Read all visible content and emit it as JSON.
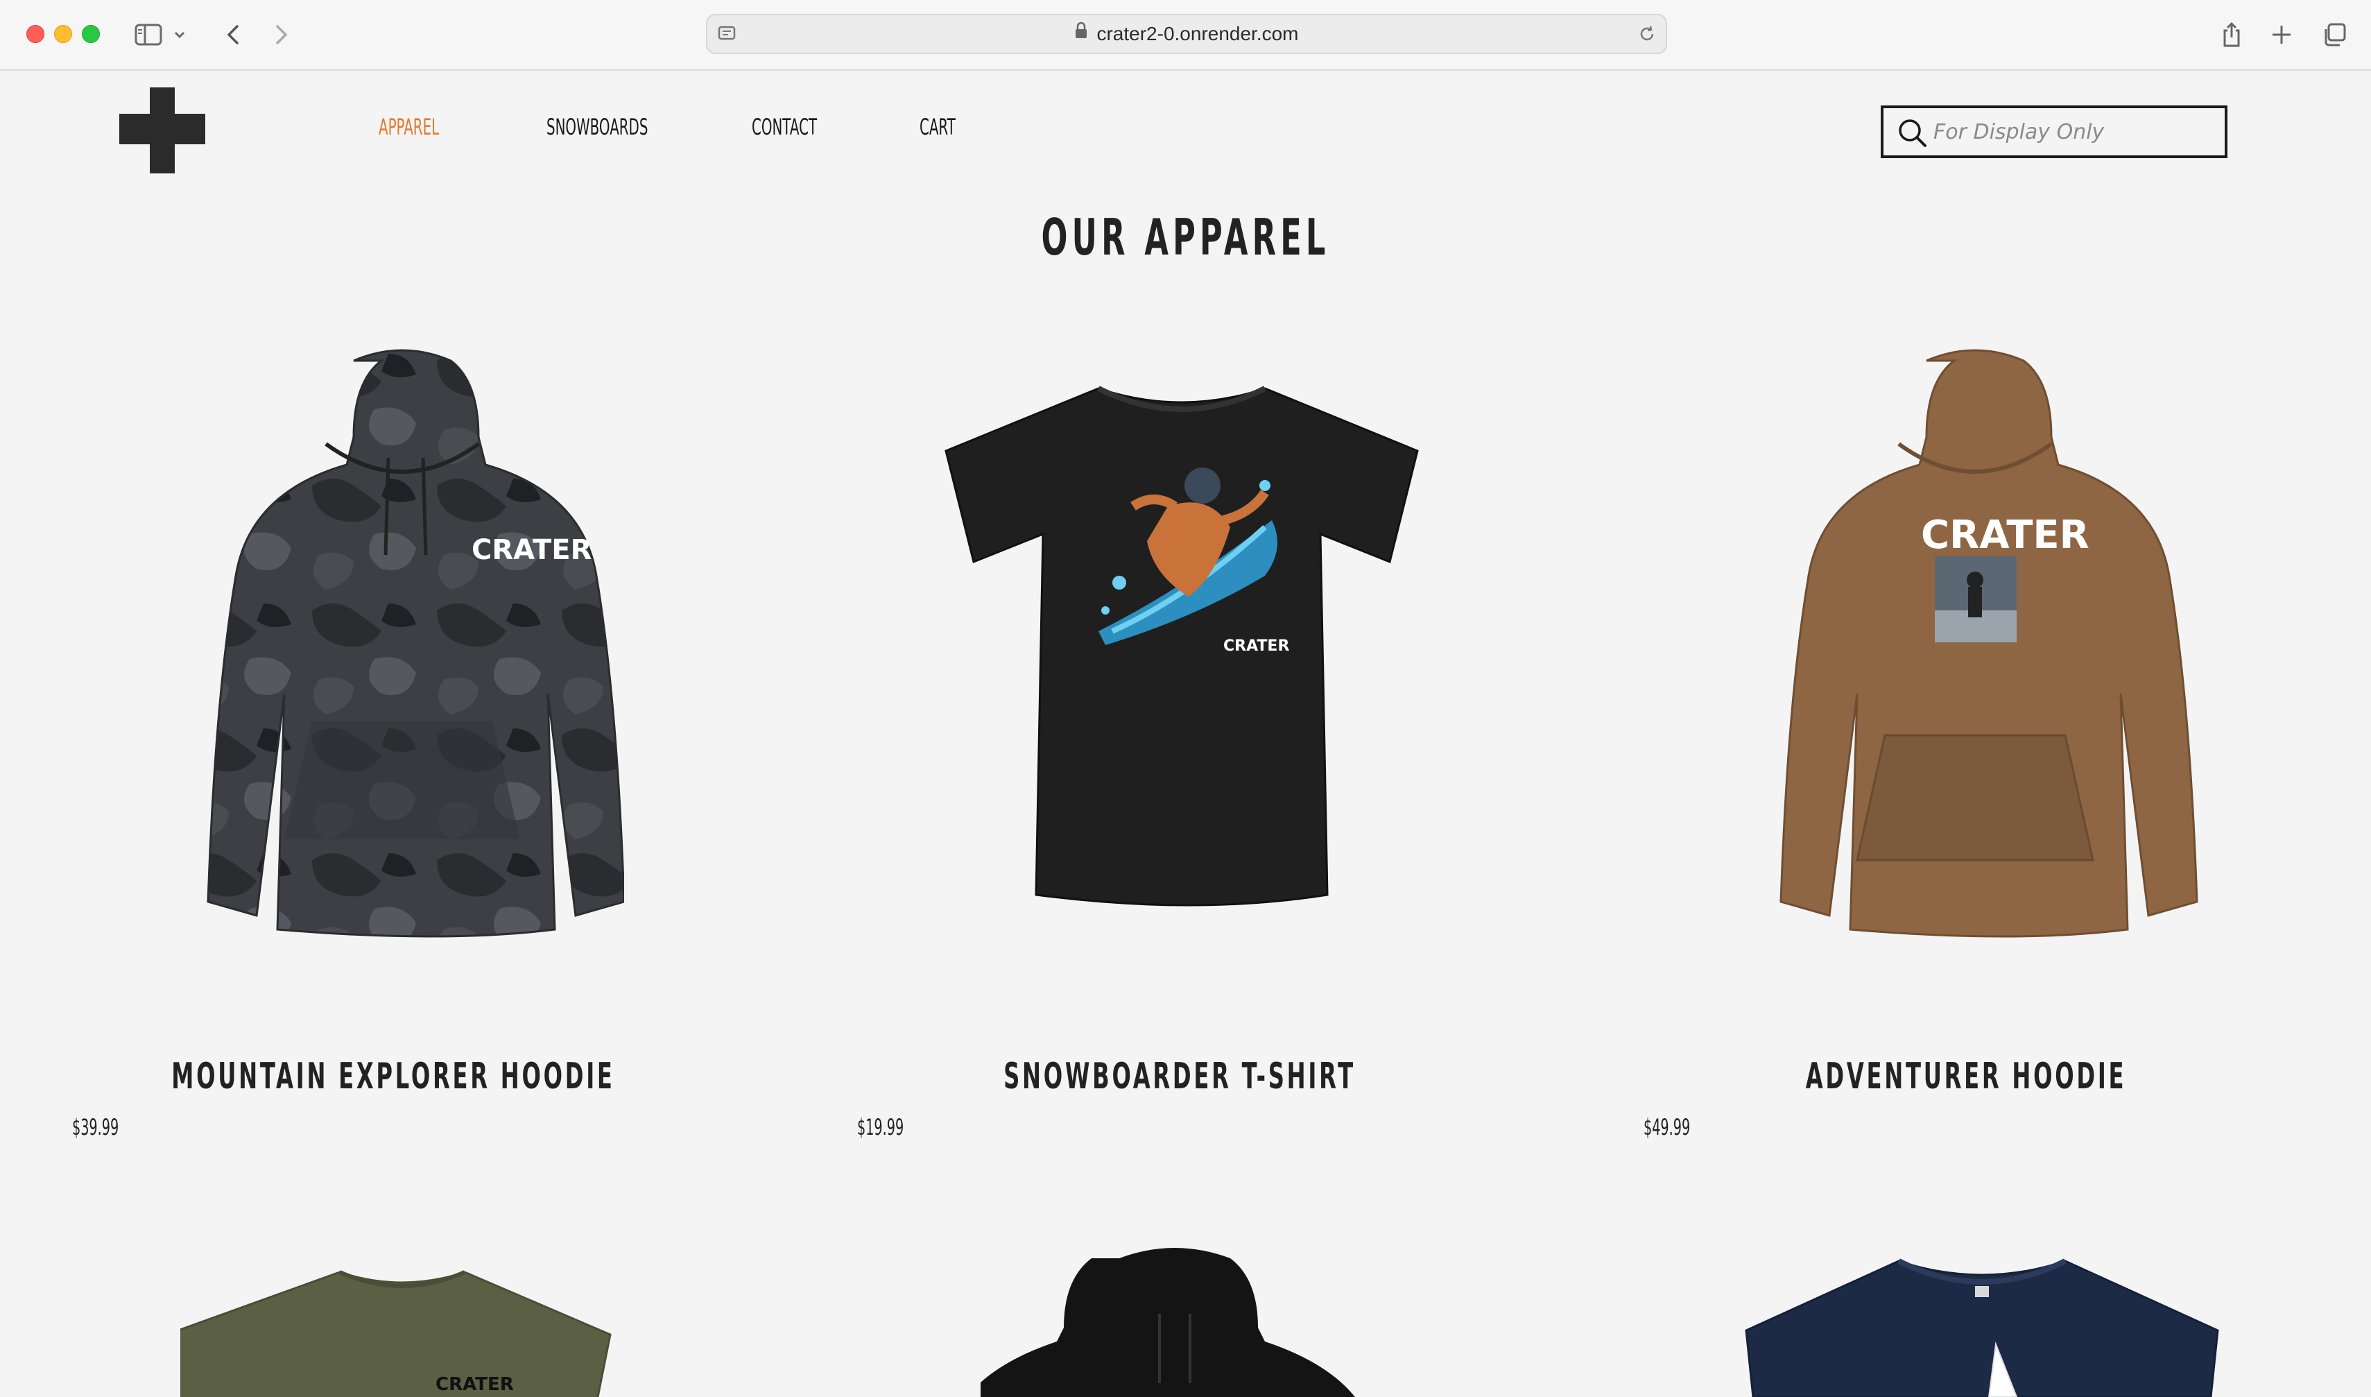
{
  "browser": {
    "url": "crater2-0.onrender.com"
  },
  "nav": {
    "items": [
      {
        "label": "APPAREL",
        "active": true
      },
      {
        "label": "SNOWBOARDS",
        "active": false
      },
      {
        "label": "CONTACT",
        "active": false
      },
      {
        "label": "CART",
        "active": false
      }
    ]
  },
  "search": {
    "placeholder": "For Display Only"
  },
  "page": {
    "title": "OUR APPAREL"
  },
  "products": [
    {
      "name": "MOUNTAIN EXPLORER HOODIE",
      "price": "$39.99",
      "graphic_text": "CRATER"
    },
    {
      "name": "SNOWBOARDER T-SHIRT",
      "price": "$19.99",
      "graphic_text": "CRATER"
    },
    {
      "name": "ADVENTURER HOODIE",
      "price": "$49.99",
      "graphic_text": "CRATER"
    },
    {
      "graphic_text": "CRATER"
    }
  ],
  "colors": {
    "accent": "#e07a2e",
    "text": "#222222",
    "background": "#f4f4f4"
  }
}
